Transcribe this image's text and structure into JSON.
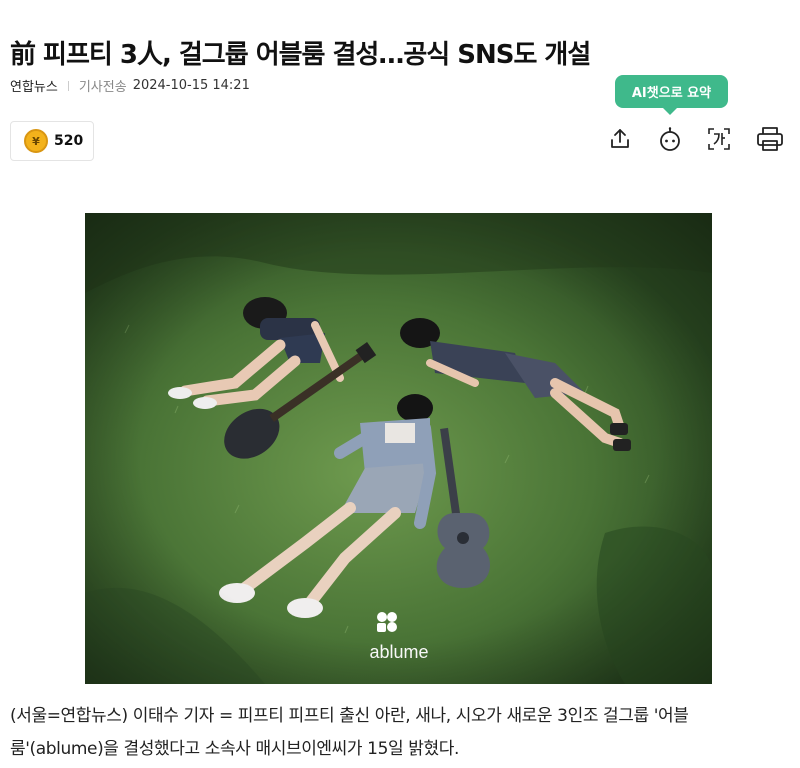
{
  "article": {
    "title": "前 피프티 3人, 걸그룹 어블룸 결성…공식 SNS도 개설",
    "source": "연합뉴스",
    "sent_label": "기사전송",
    "datetime": "2024-10-15 14:21"
  },
  "toolbar": {
    "ai_summary_tooltip": "AI챗으로 요약",
    "reward_count": "520",
    "reward_coin_symbol": "¥",
    "icons": [
      "share-icon",
      "ai-bot-icon",
      "font-size-icon",
      "print-icon"
    ]
  },
  "photo": {
    "watermark": "ablume"
  },
  "body": {
    "line1": "(서울=연합뉴스) 이태수 기자 = 피프티 피프티 출신 아란, 새나, 시오가 새로운 3인조 걸그룹 '어블",
    "line2": "룸'(ablume)을 결성했다고 소속사 매시브이엔씨가 15일 밝혔다."
  },
  "colors": {
    "accent_green": "#3fb98b",
    "coin_gold": "#f3b21b"
  }
}
